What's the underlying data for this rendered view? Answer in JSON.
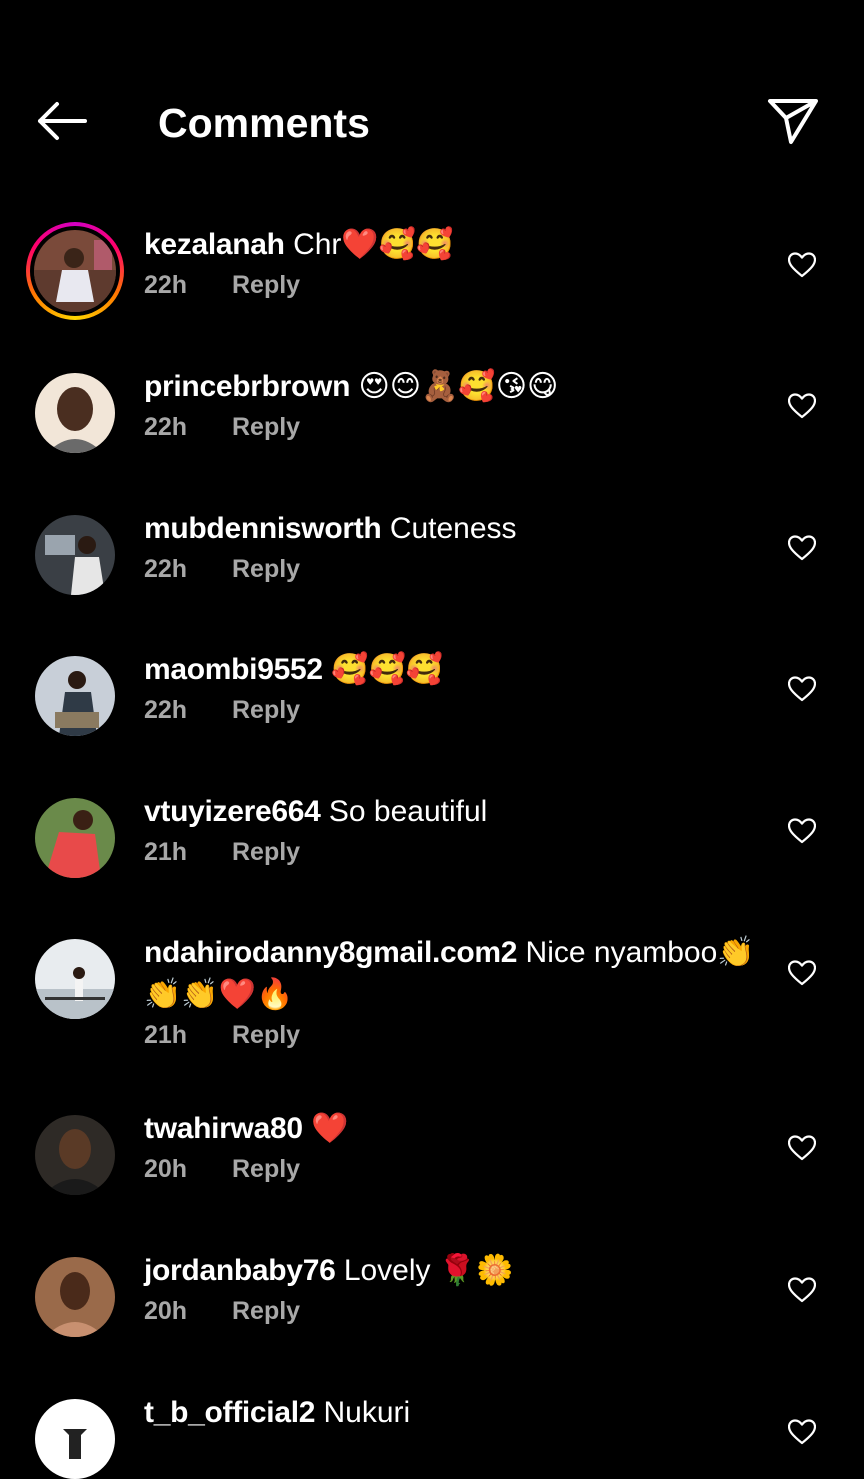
{
  "header": {
    "back_icon": "arrow-left-icon",
    "title": "Comments",
    "share_icon": "paper-plane-icon"
  },
  "colors": {
    "background": "#000000",
    "text": "#ffffff",
    "meta": "#a8a8a8",
    "story_ring": [
      "#d300c5",
      "#ff0069",
      "#ff7a00",
      "#ffd600"
    ]
  },
  "comments": [
    {
      "username": "kezalanah",
      "text": "Chr❤️🥰🥰",
      "time": "22h",
      "reply": "Reply",
      "has_story": true
    },
    {
      "username": "princebrbrown",
      "text": "😍😊🧸🥰😘😋",
      "time": "22h",
      "reply": "Reply",
      "has_story": false
    },
    {
      "username": "mubdennisworth",
      "text": "Cuteness",
      "time": "22h",
      "reply": "Reply",
      "has_story": false
    },
    {
      "username": "maombi9552",
      "text": "🥰🥰🥰",
      "time": "22h",
      "reply": "Reply",
      "has_story": false
    },
    {
      "username": "vtuyizere664",
      "text": "So beautiful",
      "time": "21h",
      "reply": "Reply",
      "has_story": false
    },
    {
      "username": "ndahirodanny8gmail.com2",
      "text": "Nice nyamboo👏👏👏❤️🔥",
      "time": "21h",
      "reply": "Reply",
      "has_story": false
    },
    {
      "username": "twahirwa80",
      "text": "❤️",
      "time": "20h",
      "reply": "Reply",
      "has_story": false
    },
    {
      "username": "jordanbaby76",
      "text": "Lovely 🌹🌼",
      "time": "20h",
      "reply": "Reply",
      "has_story": false
    },
    {
      "username": "t_b_official2",
      "text": "Nukuri",
      "time": "",
      "reply": "",
      "has_story": false
    }
  ]
}
